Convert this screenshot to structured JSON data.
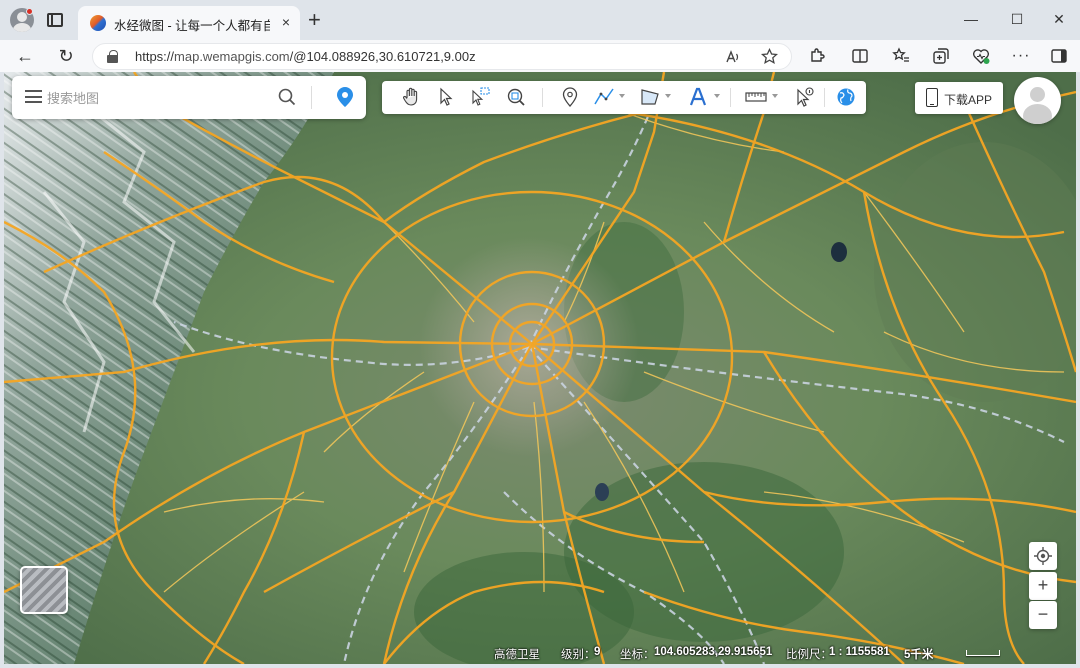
{
  "browser": {
    "tab_title": "水经微图 - 让每一个人都有自己的地图",
    "tab_close": "×",
    "new_tab": "+",
    "url_prefix": "https://",
    "url_domain": "map.wemapgis.com",
    "url_path": "/@104.088926,30.610721,9.00z",
    "window_minimize": "—",
    "window_maximize": "☐",
    "window_close": "✕"
  },
  "search": {
    "placeholder": "搜索地图"
  },
  "header": {
    "download_app_label": "下载APP"
  },
  "map_controls": {
    "zoom_in": "+",
    "zoom_out": "−"
  },
  "status": {
    "source": "高德卫星",
    "level_label": "级别：",
    "level": "9",
    "coord_label": "坐标：",
    "coordinates": "104.605283,29.915651",
    "scale_label": "比例尺：",
    "scale": "1 : 1155581",
    "scale_bar_label": "5千米"
  },
  "colors": {
    "road_primary": "#f5a623",
    "road_secondary": "#f7c95a",
    "rail": "#c9d3e0",
    "accent": "#2a8fe8"
  }
}
